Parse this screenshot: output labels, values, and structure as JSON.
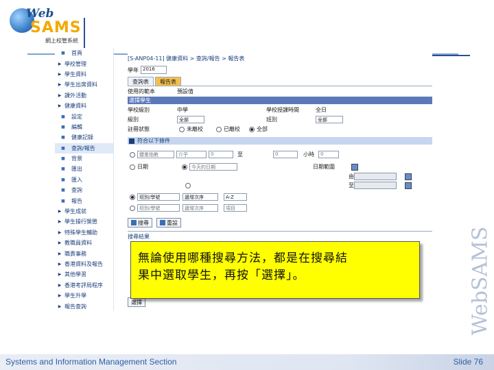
{
  "logo": {
    "brand_top": "Web",
    "brand_main": "SAMS",
    "brand_sub": "網上校管系統"
  },
  "watermark": "WebSAMS",
  "menu": [
    {
      "label": "首頁",
      "sub": true
    },
    {
      "label": "學校管理",
      "sub": false
    },
    {
      "label": "學生資料",
      "sub": false
    },
    {
      "label": "學生出席資料",
      "sub": false
    },
    {
      "label": "課外活動",
      "sub": false
    },
    {
      "label": "健康資料",
      "sub": false
    },
    {
      "label": "設定",
      "sub": true
    },
    {
      "label": "編輯",
      "sub": true
    },
    {
      "label": "健康記錄",
      "sub": true
    },
    {
      "label": "查詢/報告",
      "sub": true,
      "active": true
    },
    {
      "label": "背景",
      "sub": true
    },
    {
      "label": "匯出",
      "sub": true
    },
    {
      "label": "匯入",
      "sub": true
    },
    {
      "label": "查詢",
      "sub": true
    },
    {
      "label": "報告",
      "sub": true
    },
    {
      "label": "學生成就",
      "sub": false
    },
    {
      "label": "學生操行獎懲",
      "sub": false
    },
    {
      "label": "特殊學生輔助",
      "sub": false
    },
    {
      "label": "教職員資料",
      "sub": false
    },
    {
      "label": "職責事務",
      "sub": false
    },
    {
      "label": "香港資料及報告",
      "sub": false
    },
    {
      "label": "其他學習",
      "sub": false
    },
    {
      "label": "香港考評局程序",
      "sub": false
    },
    {
      "label": "學生升學",
      "sub": false
    },
    {
      "label": "報告查詢",
      "sub": false
    }
  ],
  "app": {
    "breadcrumb": "[S-ANP04-11] 健康資料 > 查詢/報告 > 報告表",
    "year_label": "學年",
    "year_value": "2016",
    "tabs": [
      "查詢表",
      "報告表"
    ],
    "used_template_label": "使用的範本",
    "used_template_value": "預設值",
    "section_select": "選擇學生",
    "school_level_label": "學校級別",
    "school_level_value": "中學",
    "school_session_label": "學校授課時間",
    "school_session_value": "全日",
    "class_level_label": "級別",
    "class_level_value": "全部",
    "class_label": "班別",
    "class_value": "全部",
    "status_label": "註冊狀態",
    "status_options": [
      "未離校",
      "已離校",
      "全部"
    ],
    "section_conditions": "符合以下條件",
    "cond_field": "體重指數",
    "cond_op": "介乎",
    "cond_from": "0",
    "cond_to_label": "至",
    "cond_to": "0",
    "cond_unit": "小時",
    "cond_unit_value": "0",
    "cond_date_label": "日期",
    "cond_range_label": "日期範圍",
    "cond_date_value": "今天的日期",
    "date_from_label": "由",
    "date_to_label": "至",
    "sort1_field": "班別/學號",
    "sort1_order": "遞增次序",
    "sort1_opt": "A-Z",
    "sort2_field": "班別/學號",
    "sort2_order": "遞增次序",
    "sort2_opt": "項目",
    "search_button": "搜尋",
    "reset_button": "重設",
    "result_header": "搜尋結果",
    "select_button": "選擇"
  },
  "callout": {
    "line1": "無論使用哪種搜尋方法，都是在搜尋結",
    "line2": "果中選取學生，再按「選擇」。"
  },
  "footer": {
    "left": "Systems and Information Management Section",
    "right": "Slide 76"
  }
}
